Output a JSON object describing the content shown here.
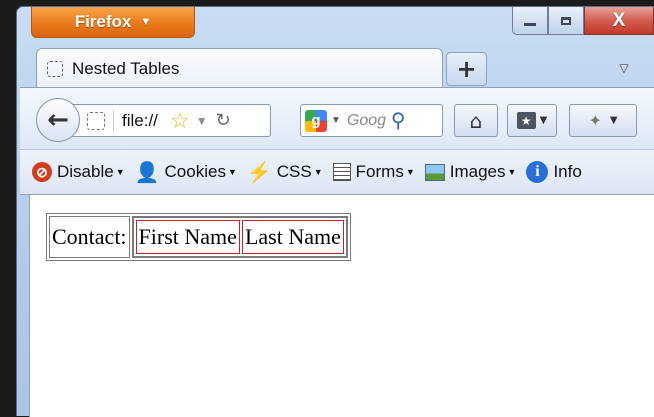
{
  "titlebar": {
    "app_button_label": "Firefox",
    "minimize_glyph": "",
    "maximize_glyph": "",
    "close_glyph": "X"
  },
  "tabs": [
    {
      "label": "Nested Tables",
      "icon": "page-icon",
      "active": true
    }
  ],
  "new_tab_glyph": "+",
  "navigation": {
    "url": "file://",
    "search_placeholder": "Goog",
    "search_engine_icon": "google-icon"
  },
  "dev_toolbar": {
    "items": [
      {
        "label": "Disable",
        "icon": "disable-icon"
      },
      {
        "label": "Cookies",
        "icon": "person-icon"
      },
      {
        "label": "CSS",
        "icon": "wand-icon"
      },
      {
        "label": "Forms",
        "icon": "forms-icon"
      },
      {
        "label": "Images",
        "icon": "images-icon"
      },
      {
        "label": "Info",
        "icon": "info-icon"
      }
    ]
  },
  "page": {
    "contact_label": "Contact:",
    "first_name": "First Name",
    "last_name": "Last Name"
  },
  "colors": {
    "firefox_orange": "#ea7b1b",
    "close_red": "#d0584a",
    "inner_cell_border": "#cc2020"
  }
}
